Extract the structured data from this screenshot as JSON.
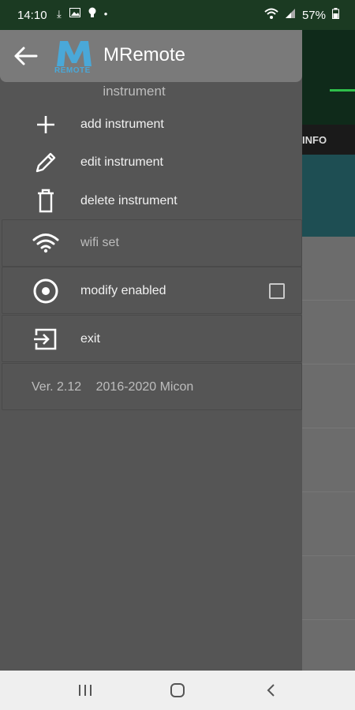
{
  "status_bar": {
    "time": "14:10",
    "battery": "57%"
  },
  "background_app": {
    "tab_label": "INFO"
  },
  "drawer": {
    "title": "MRemote",
    "logo_letter": "M",
    "logo_subtext": "REMOTE",
    "section_label": "instrument",
    "items": [
      {
        "label": "add instrument",
        "icon": "plus-icon"
      },
      {
        "label": "edit instrument",
        "icon": "pencil-icon"
      },
      {
        "label": "delete instrument",
        "icon": "trash-icon"
      },
      {
        "label": "wifi set",
        "icon": "wifi-icon",
        "enabled": false
      },
      {
        "label": "modify enabled",
        "icon": "radio-button-icon",
        "checked": false
      },
      {
        "label": "exit",
        "icon": "exit-icon"
      }
    ],
    "version": "Ver. 2.12",
    "copyright": "2016-2020 Micon"
  },
  "colors": {
    "drawer_bg": "#555555",
    "header_bg": "#7a7a7a",
    "logo_blue": "#4aa8d8",
    "status_bar_bg": "#1b3a22"
  }
}
